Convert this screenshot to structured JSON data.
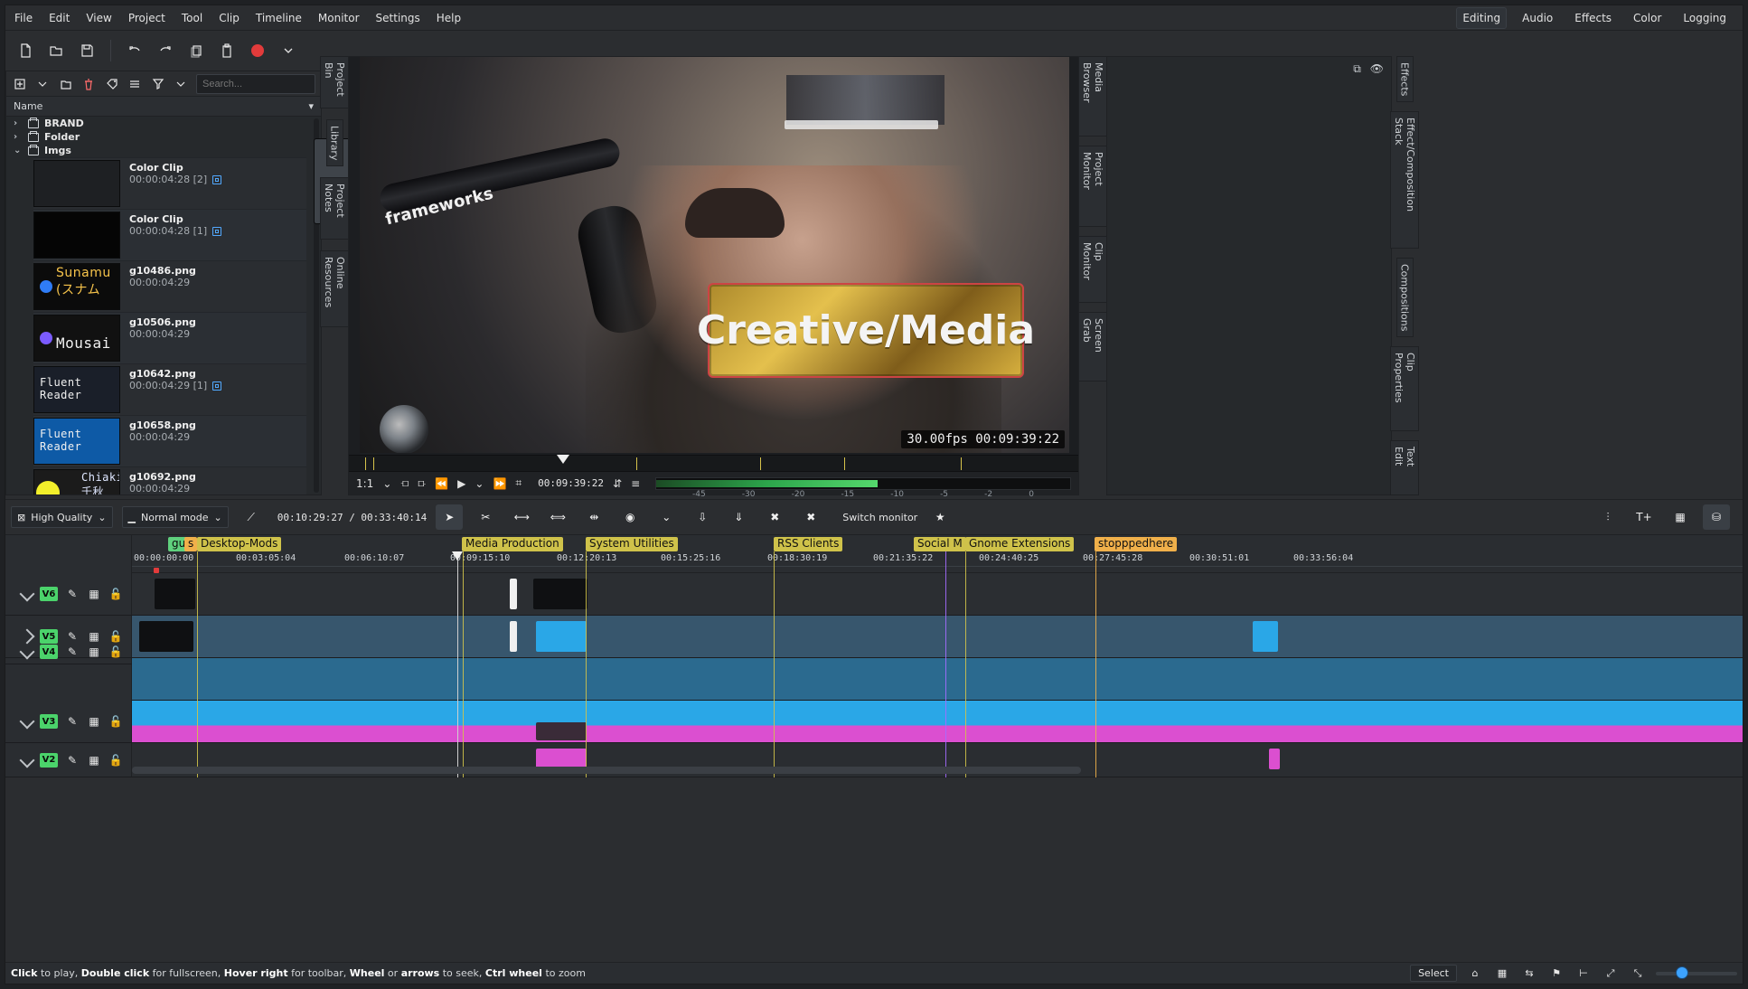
{
  "app": {
    "menus": [
      "File",
      "Edit",
      "View",
      "Project",
      "Tool",
      "Clip",
      "Timeline",
      "Monitor",
      "Settings",
      "Help"
    ],
    "layouts": [
      "Editing",
      "Audio",
      "Effects",
      "Color",
      "Logging"
    ],
    "active_layout": "Editing"
  },
  "bin": {
    "search_placeholder": "Search...",
    "header": "Name",
    "folders": [
      {
        "name": "BRAND",
        "expanded": false
      },
      {
        "name": "Folder",
        "expanded": false
      },
      {
        "name": "Imgs",
        "expanded": true
      }
    ],
    "items": [
      {
        "name": "Color Clip",
        "duration": "00:00:04:28 [2]",
        "thumb": "blank"
      },
      {
        "name": "Color Clip",
        "duration": "00:00:04:28 [1]",
        "thumb": "black"
      },
      {
        "name": "g10486.png",
        "duration": "00:00:04:29",
        "thumb_text": "Sunamu (スナム",
        "thumb": "sun"
      },
      {
        "name": "g10506.png",
        "duration": "00:00:04:29",
        "thumb_text": "Mousai",
        "thumb": "mou"
      },
      {
        "name": "g10642.png",
        "duration": "00:00:04:29 [1]",
        "thumb_text": "Fluent Reader",
        "thumb": "flu"
      },
      {
        "name": "g10658.png",
        "duration": "00:00:04:29",
        "thumb_text": "Fluent Reader",
        "thumb": "flu2"
      },
      {
        "name": "g10692.png",
        "duration": "00:00:04:29",
        "thumb_text": "Chiaki 千秋",
        "thumb": "chiaki"
      }
    ]
  },
  "left_vtabs": [
    "Project Bin",
    "Library",
    "Project Notes",
    "Online Resources"
  ],
  "monitor": {
    "overlay_timecode": "30.00fps 00:09:39:22",
    "title_card": "Creative/Media",
    "brand_text": "frameworks",
    "zoom": "1:1",
    "timecode": "00:09:39:22",
    "meter_scale": [
      "-45",
      "-30",
      "-20",
      "-15",
      "-10",
      "-5",
      "-2",
      "0"
    ]
  },
  "mid_vtabs": [
    "Media Browser",
    "Project Monitor",
    "Clip Monitor",
    "Screen Grab"
  ],
  "right_vtabs": [
    "Effects",
    "Effect/Composition Stack",
    "Compositions",
    "Clip Properties",
    "Text Edit"
  ],
  "timeline_toolbar": {
    "quality": "High Quality",
    "mode": "Normal mode",
    "time": "00:10:29:27 / 00:33:40:14",
    "switch_monitor": "Switch monitor"
  },
  "timeline": {
    "markers": [
      {
        "label": "gu",
        "color": "green"
      },
      {
        "label": "s",
        "color": "orange"
      },
      {
        "label": "Desktop-Mods",
        "color": "yellow"
      },
      {
        "label": "Media Production",
        "color": "yellow"
      },
      {
        "label": "System Utilities",
        "color": "yellow"
      },
      {
        "label": "RSS Clients",
        "color": "yellow"
      },
      {
        "label": "Social M",
        "color": "yellow"
      },
      {
        "label": "Gnome Extensions",
        "color": "yellow"
      },
      {
        "label": "stopppedhere",
        "color": "orange"
      }
    ],
    "ticks": [
      "00:00:00:00",
      "00:03:05:04",
      "00:06:10:07",
      "00:09:15:10",
      "00:12:20:13",
      "00:15:25:16",
      "00:18:30:19",
      "00:21:35:22",
      "00:24:40:25",
      "00:27:45:28",
      "00:30:51:01",
      "00:33:56:04"
    ],
    "tracks": [
      "V6",
      "V5",
      "V4",
      "V3",
      "V2"
    ]
  },
  "statusbar": {
    "hint_parts": [
      {
        "b": "Click",
        "t": " to play, "
      },
      {
        "b": "Double click",
        "t": " for fullscreen, "
      },
      {
        "b": "Hover right",
        "t": " for toolbar, "
      },
      {
        "b": "Wheel",
        "t": " or "
      },
      {
        "b": "arrows",
        "t": " to seek, "
      },
      {
        "b": "Ctrl wheel",
        "t": " to zoom"
      }
    ],
    "select_label": "Select"
  }
}
